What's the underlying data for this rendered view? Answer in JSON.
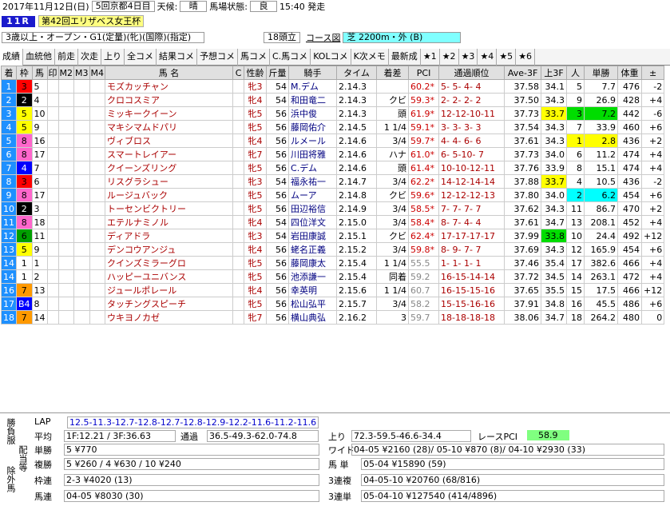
{
  "header": {
    "date": "2017年11月12日(日)",
    "meeting": "5回京都4日目",
    "weather_label": "天候:",
    "weather": "晴",
    "track_label": "馬場状態:",
    "track": "良",
    "post_time": "15:40 発走",
    "race_no": "11R",
    "race_name": "第42回エリザベス女王杯"
  },
  "conditions": {
    "class": "3歳以上・オープン・G1(定量)(牝)(国際)(指定)",
    "runners": "18頭立",
    "course_label": "コース図",
    "course": "芝 2200m・外 (B)"
  },
  "tabs": [
    "成績",
    "血統他",
    "前走",
    "次走",
    "上り",
    "全コメ",
    "結果コメ",
    "予想コメ",
    "馬コメ",
    "C.馬コメ",
    "KOLコメ",
    "K次メモ",
    "最新成",
    "★1",
    "★2",
    "★3",
    "★4",
    "★5",
    "★6"
  ],
  "columns": [
    "着",
    "枠",
    "馬",
    "印",
    "M2",
    "M3",
    "M4",
    "馬 名",
    "C",
    "性齢",
    "斤量",
    "騎手",
    "タイム",
    "着差",
    "PCI",
    "通過順位",
    "Ave-3F",
    "上3F",
    "人",
    "単勝",
    "体重",
    "±"
  ],
  "rows": [
    [
      "1",
      "3",
      "5",
      "",
      "",
      "",
      "",
      "モズカッチャン",
      "",
      "牝3",
      "54",
      "M.デム",
      "2.14.3",
      "",
      "60.2*",
      "5- 5- 4- 4",
      "37.58",
      "34.1",
      "5",
      "7.7",
      "476",
      "-2"
    ],
    [
      "2",
      "2",
      "4",
      "",
      "",
      "",
      "",
      "クロコスミア",
      "",
      "牝4",
      "54",
      "和田竜二",
      "2.14.3",
      "クビ",
      "59.3*",
      "2- 2- 2- 2",
      "37.50",
      "34.3",
      "9",
      "26.9",
      "428",
      "+4"
    ],
    [
      "3",
      "5",
      "10",
      "",
      "",
      "",
      "",
      "ミッキークイーン",
      "",
      "牝5",
      "56",
      "浜中俊",
      "2.14.3",
      "頭",
      "61.9*",
      "12-12-10-11",
      "37.73",
      "33.7",
      "3",
      "7.2",
      "442",
      "-6"
    ],
    [
      "4",
      "5",
      "9",
      "",
      "",
      "",
      "",
      "マキシマムドパリ",
      "",
      "牝5",
      "56",
      "藤岡佑介",
      "2.14.5",
      "1 1/4",
      "59.1*",
      "3- 3- 3- 3",
      "37.54",
      "34.3",
      "7",
      "33.9",
      "460",
      "+6"
    ],
    [
      "5",
      "8",
      "16",
      "",
      "",
      "",
      "",
      "ヴィブロス",
      "",
      "牝4",
      "56",
      "ルメール",
      "2.14.6",
      "3/4",
      "59.7*",
      "4- 4- 6- 6",
      "37.61",
      "34.3",
      "1",
      "2.8",
      "436",
      "+2"
    ],
    [
      "6",
      "8",
      "17",
      "",
      "",
      "",
      "",
      "スマートレイアー",
      "",
      "牝7",
      "56",
      "川田将雅",
      "2.14.6",
      "ハナ",
      "61.0*",
      "6- 5-10- 7",
      "37.73",
      "34.0",
      "6",
      "11.2",
      "474",
      "+4"
    ],
    [
      "7",
      "4",
      "7",
      "",
      "",
      "",
      "",
      "クイーンズリング",
      "",
      "牝5",
      "56",
      "C.デム",
      "2.14.6",
      "頭",
      "61.4*",
      "10-10-12-11",
      "37.76",
      "33.9",
      "8",
      "15.1",
      "474",
      "+4"
    ],
    [
      "8",
      "3",
      "6",
      "",
      "",
      "",
      "",
      "リスグラシュー",
      "",
      "牝3",
      "54",
      "福永祐一",
      "2.14.7",
      "3/4",
      "62.2*",
      "14-12-14-14",
      "37.88",
      "33.7",
      "4",
      "10.5",
      "436",
      "-2"
    ],
    [
      "9",
      "8",
      "17",
      "",
      "",
      "",
      "",
      "ルージュバック",
      "",
      "牝5",
      "56",
      "ムーア",
      "2.14.8",
      "クビ",
      "59.6*",
      "12-12-12-13",
      "37.80",
      "34.0",
      "2",
      "6.2",
      "454",
      "+6"
    ],
    [
      "10",
      "2",
      "3",
      "",
      "",
      "",
      "",
      "トーセンビクトリー",
      "",
      "牝5",
      "56",
      "田辺裕信",
      "2.14.9",
      "3/4",
      "58.5*",
      "7- 7- 7- 7",
      "37.62",
      "34.3",
      "11",
      "86.7",
      "470",
      "+2"
    ],
    [
      "11",
      "8",
      "18",
      "",
      "",
      "",
      "",
      "エテルナミノル",
      "",
      "牝4",
      "54",
      "四位洋文",
      "2.15.0",
      "3/4",
      "58.4*",
      "8- 7- 4- 4",
      "37.61",
      "34.7",
      "13",
      "208.1",
      "452",
      "+4"
    ],
    [
      "12",
      "6",
      "11",
      "",
      "",
      "",
      "",
      "ディアドラ",
      "",
      "牝3",
      "54",
      "岩田康誠",
      "2.15.1",
      "クビ",
      "62.4*",
      "17-17-17-17",
      "37.99",
      "33.8",
      "10",
      "24.4",
      "492",
      "+12"
    ],
    [
      "13",
      "5",
      "9",
      "",
      "",
      "",
      "",
      "デンコウアンジュ",
      "",
      "牝4",
      "56",
      "蛯名正義",
      "2.15.2",
      "3/4",
      "59.8*",
      "8- 9- 7- 7",
      "37.69",
      "34.3",
      "12",
      "165.9",
      "454",
      "+6"
    ],
    [
      "14",
      "1",
      "1",
      "",
      "",
      "",
      "",
      "クインズミラーグロ",
      "",
      "牝5",
      "56",
      "藤岡康太",
      "2.15.4",
      "1 1/4",
      "55.5",
      "1- 1- 1- 1",
      "37.46",
      "35.4",
      "17",
      "382.6",
      "466",
      "+4"
    ],
    [
      "14",
      "1",
      "2",
      "",
      "",
      "",
      "",
      "ハッピーユニバンス",
      "",
      "牝5",
      "56",
      "池添謙一",
      "2.15.4",
      "同着",
      "59.2",
      "16-15-14-14",
      "37.72",
      "34.5",
      "14",
      "263.1",
      "472",
      "+4"
    ],
    [
      "16",
      "7",
      "13",
      "",
      "",
      "",
      "",
      "ジュールポレール",
      "",
      "牝4",
      "56",
      "幸英明",
      "2.15.6",
      "1 1/4",
      "60.7",
      "16-15-15-16",
      "37.65",
      "35.5",
      "15",
      "17.5",
      "466",
      "+12"
    ],
    [
      "17",
      "B4",
      "8",
      "",
      "",
      "",
      "",
      "タッチングスピーチ",
      "",
      "牝5",
      "56",
      "松山弘平",
      "2.15.7",
      "3/4",
      "58.2",
      "15-15-16-16",
      "37.91",
      "34.8",
      "16",
      "45.5",
      "486",
      "+6"
    ],
    [
      "18",
      "7",
      "14",
      "",
      "",
      "",
      "",
      "ウキヨノカゼ",
      "",
      "牝7",
      "56",
      "横山典弘",
      "2.16.2",
      "3",
      "59.7",
      "18-18-18-18",
      "38.06",
      "34.7",
      "18",
      "264.2",
      "480",
      "0"
    ]
  ],
  "bottom": {
    "side1": "勝負服",
    "side2": "配当等",
    "side3": "除外馬",
    "lap_label": "LAP",
    "lap": "12.5-11.3-12.7-12.8-12.7-12.8-12.9-12.2-11.6-11.2-11.6",
    "avg_label": "平均",
    "avg": "1F:12.21 / 3F:36.63",
    "pass_label": "通過",
    "pass": "36.5-49.3-62.0-74.8",
    "up_label": "上り",
    "up": "72.3-59.5-46.6-34.4",
    "rpci_label": "レースPCI",
    "rpci": "58.9",
    "win_label": "単勝",
    "win": "5 ¥770",
    "place_label": "複勝",
    "place": "5 ¥260 / 4 ¥630 / 10 ¥240",
    "waku_label": "枠連",
    "waku": "2-3 ¥4020 (13)",
    "umaren_label": "馬連",
    "umaren": "04-05 ¥8030 (30)",
    "wide_label": "ワイド",
    "wide": "04-05 ¥2160 (28)/ 05-10 ¥870 (8)/ 04-10 ¥2930 (33)",
    "umatan_label": "馬 単",
    "umatan": "05-04 ¥15890 (59)",
    "trio_label": "3連複",
    "trio": "04-05-10 ¥20760 (68/816)",
    "trifecta_label": "3連単",
    "trifecta": "05-04-10 ¥127540 (414/4896)"
  },
  "colors": {
    "rank_bg": "#1e90ff",
    "waku": [
      "#ffffff",
      "#000000",
      "#ff0000",
      "#0000ff",
      "#ffff00",
      "#00a000",
      "#ff9900",
      "#ff66cc"
    ],
    "hl_yellow": "#ffff00",
    "hl_green": "#00dd00",
    "hl_cyan": "#00ffff"
  }
}
